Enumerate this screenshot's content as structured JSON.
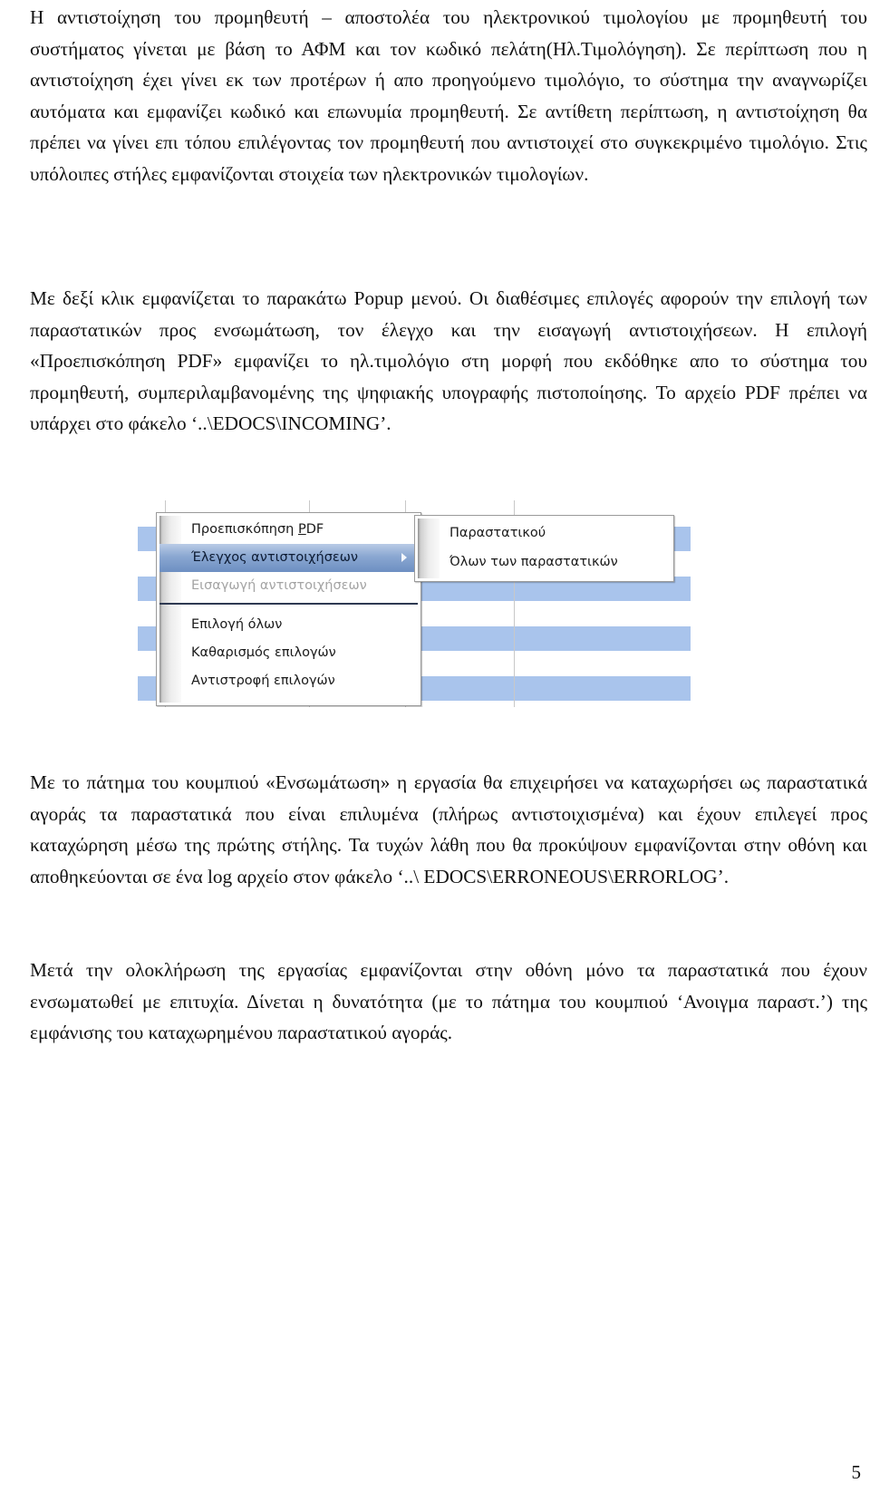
{
  "paragraphs": {
    "p1": "Η αντιστοίχηση του προμηθευτή – αποστολέα του ηλεκτρονικού τιμολογίου με προμηθευτή του συστήματος γίνεται με βάση το ΑΦΜ και τον κωδικό πελάτη(Ηλ.Τιμολόγηση). Σε περίπτωση που η αντιστοίχηση έχει γίνει εκ των προτέρων ή απο προηγούμενο τιμολόγιο, το σύστημα την αναγνωρίζει αυτόματα και εμφανίζει κωδικό και επωνυμία προμηθευτή. Σε αντίθετη περίπτωση, η αντιστοίχηση θα πρέπει να γίνει επι τόπου επιλέγοντας τον προμηθευτή που αντιστοιχεί στο συγκεκριμένο τιμολόγιο. Στις υπόλοιπες στήλες εμφανίζονται στοιχεία των ηλεκτρονικών τιμολογίων.",
    "p2": "Με δεξί κλικ εμφανίζεται το παρακάτω Popup μενού. Οι διαθέσιμες επιλογές αφορούν την επιλογή των παραστατικών προς ενσωμάτωση, τον έλεγχο και την εισαγωγή αντιστοιχήσεων. Η επιλογή «Προεπισκόπηση  PDF» εμφανίζει το ηλ.τιμολόγιο στη μορφή που εκδόθηκε απο το σύστημα του προμηθευτή, συμπεριλαμβανομένης της ψηφιακής υπογραφής πιστοποίησης. Το αρχείο PDF πρέπει να υπάρχει στο φάκελο ‘..\\EDOCS\\INCOMING’.",
    "p3": "Με το πάτημα του κουμπιού «Ενσωμάτωση» η εργασία θα επιχειρήσει να καταχωρήσει ως παραστατικά αγοράς τα παραστατικά που είναι επιλυμένα (πλήρως αντιστοιχισμένα) και έχουν επιλεγεί προς καταχώρηση μέσω της πρώτης στήλης. Τα τυχών λάθη που θα προκύψουν εμφανίζονται στην οθόνη και αποθηκεύονται σε ένα log αρχείο στον φάκελο ‘..\\ EDOCS\\ERRONEOUS\\ERRORLOG’.",
    "p4": "Μετά την ολοκλήρωση της εργασίας εμφανίζονται στην οθόνη μόνο τα παραστατικά που έχουν ενσωματωθεί με επιτυχία. Δίνεται η δυνατότητα (με το πάτημα του κουμπιού ‘Ανοιγμα παραστ.’) της εμφάνισης του καταχωρημένου παραστατικού αγοράς."
  },
  "popup_menu": {
    "items": [
      {
        "label_pre": "Προεπισκόπηση ",
        "label_mnemonic": "P",
        "label_post": "DF",
        "state": "normal"
      },
      {
        "label": "Έλεγχος αντιστοιχήσεων",
        "state": "highlighted",
        "has_submenu": true
      },
      {
        "label": "Εισαγωγή αντιστοιχήσεων",
        "state": "disabled"
      },
      {
        "label": "Επιλογή όλων",
        "state": "normal"
      },
      {
        "label": "Καθαρισμός επιλογών",
        "state": "normal"
      },
      {
        "label": "Αντιστροφή επιλογών",
        "state": "normal"
      }
    ],
    "submenu": {
      "items": [
        {
          "label": "Παραστατικού"
        },
        {
          "label": "Όλων των παραστατικών"
        }
      ]
    }
  },
  "colors": {
    "row_stripe": "#a9c4ec",
    "highlight": "#7f9dcb",
    "disabled_text": "#a4a4a4"
  },
  "page_number": "5"
}
